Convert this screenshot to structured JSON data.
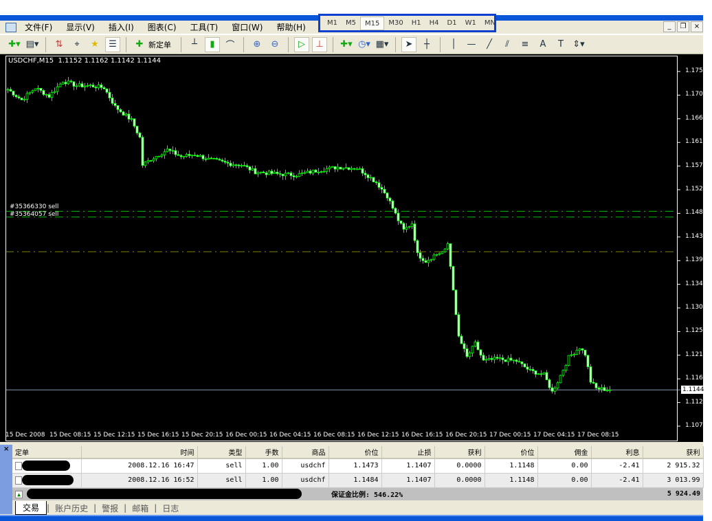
{
  "menu": [
    "文件(F)",
    "显示(V)",
    "插入(I)",
    "图表(C)",
    "工具(T)",
    "窗口(W)",
    "帮助(H)"
  ],
  "toolbar": {
    "new_order": "新定单"
  },
  "timeframes": [
    "M1",
    "M5",
    "M15",
    "M30",
    "H1",
    "H4",
    "D1",
    "W1",
    "MN"
  ],
  "active_timeframe": "M15",
  "chart": {
    "header": "USDCHF,M15  1.1152 1.1162 1.1142 1.1144",
    "bid_label": "1.1144",
    "orders": [
      {
        "label": "#35366330 sell",
        "price": 1.1484
      },
      {
        "label": "#35364057 sell",
        "price": 1.1473
      }
    ],
    "stop_loss": 1.1407
  },
  "chart_data": {
    "type": "candlestick",
    "symbol": "USDCHF",
    "timeframe": "M15",
    "y_ticks": [
      "1.1750",
      "1.1705",
      "1.1660",
      "1.1615",
      "1.1570",
      "1.1525",
      "1.1480",
      "1.1435",
      "1.1390",
      "1.1345",
      "1.1300",
      "1.1255",
      "1.1210",
      "1.1165",
      "1.1120",
      "1.1075"
    ],
    "ylim": [
      1.1075,
      1.175
    ],
    "x_ticks": [
      "15 Dec 2008",
      "15 Dec 08:15",
      "15 Dec 12:15",
      "15 Dec 16:15",
      "15 Dec 20:15",
      "16 Dec 00:15",
      "16 Dec 04:15",
      "16 Dec 08:15",
      "16 Dec 12:15",
      "16 Dec 16:15",
      "16 Dec 20:15",
      "17 Dec 00:15",
      "17 Dec 04:15",
      "17 Dec 08:15"
    ],
    "bars_per_tick": 16,
    "close_path": [
      [
        0,
        1.1716
      ],
      [
        5,
        1.1696
      ],
      [
        10,
        1.1719
      ],
      [
        15,
        1.1703
      ],
      [
        20,
        1.1732
      ],
      [
        25,
        1.1723
      ],
      [
        30,
        1.1723
      ],
      [
        35,
        1.1719
      ],
      [
        39,
        1.1683
      ],
      [
        45,
        1.1657
      ],
      [
        48,
        1.1624
      ],
      [
        49,
        1.1572
      ],
      [
        52,
        1.1583
      ],
      [
        58,
        1.1601
      ],
      [
        63,
        1.1588
      ],
      [
        68,
        1.1592
      ],
      [
        73,
        1.1583
      ],
      [
        80,
        1.1575
      ],
      [
        85,
        1.1572
      ],
      [
        90,
        1.1559
      ],
      [
        98,
        1.1555
      ],
      [
        105,
        1.1553
      ],
      [
        113,
        1.1562
      ],
      [
        120,
        1.1568
      ],
      [
        127,
        1.1566
      ],
      [
        130,
        1.1556
      ],
      [
        134,
        1.1539
      ],
      [
        138,
        1.1513
      ],
      [
        142,
        1.1467
      ],
      [
        144,
        1.1448
      ],
      [
        147,
        1.1461
      ],
      [
        149,
        1.1402
      ],
      [
        152,
        1.1389
      ],
      [
        155,
        1.14
      ],
      [
        159,
        1.1409
      ],
      [
        160,
        1.1422
      ],
      [
        162,
        1.1337
      ],
      [
        163,
        1.1284
      ],
      [
        164,
        1.1245
      ],
      [
        167,
        1.1206
      ],
      [
        170,
        1.1232
      ],
      [
        173,
        1.1199
      ],
      [
        178,
        1.1203
      ],
      [
        185,
        1.1199
      ],
      [
        190,
        1.118
      ],
      [
        195,
        1.1173
      ],
      [
        198,
        1.114
      ],
      [
        200,
        1.116
      ],
      [
        204,
        1.1206
      ],
      [
        208,
        1.1225
      ],
      [
        210,
        1.1212
      ],
      [
        212,
        1.116
      ],
      [
        214,
        1.1147
      ],
      [
        219,
        1.1144
      ]
    ]
  },
  "terminal": {
    "columns": [
      "定单",
      "时间",
      "类型",
      "手数",
      "商品",
      "价位",
      "止损",
      "获利",
      "价位",
      "佣金",
      "利息",
      "获利"
    ],
    "rows": [
      [
        "",
        "2008.12.16 16:47",
        "sell",
        "1.00",
        "usdchf",
        "1.1473",
        "1.1407",
        "0.0000",
        "1.1148",
        "0.00",
        "-2.41",
        "2 915.32"
      ],
      [
        "",
        "2008.12.16 16:52",
        "sell",
        "1.00",
        "usdchf",
        "1.1484",
        "1.1407",
        "0.0000",
        "1.1148",
        "0.00",
        "-2.41",
        "3 013.99"
      ]
    ],
    "margin_level": "保证金比例: 546.22%",
    "total_profit": "5 924.49",
    "tabs": [
      "交易",
      "账户历史",
      "警报",
      "邮箱",
      "日志"
    ],
    "close": "×"
  },
  "colors": {
    "bull": "#00ff00",
    "bear": "#00ff00",
    "bg": "#000000",
    "order_line": "#00c000",
    "sl_line": "#808000"
  }
}
